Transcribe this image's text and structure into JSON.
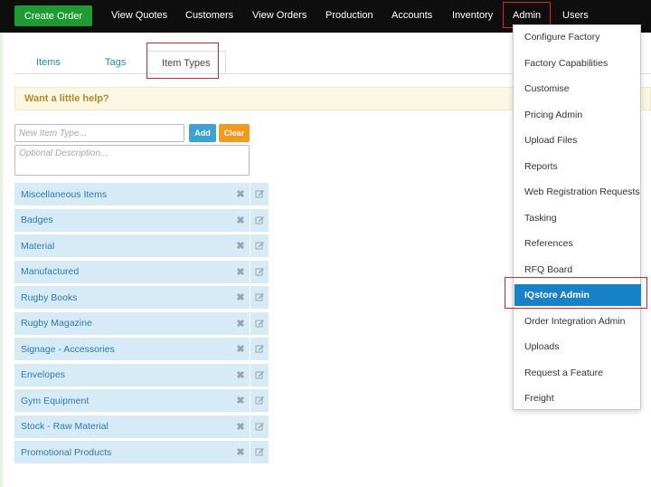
{
  "navbar": {
    "create_order": "Create Order",
    "links": [
      "View Quotes",
      "Customers",
      "View Orders",
      "Production",
      "Accounts",
      "Inventory",
      "Admin",
      "Users"
    ]
  },
  "tabs": [
    "Items",
    "Tags",
    "Item Types"
  ],
  "help": {
    "text": "Want a little help?"
  },
  "form": {
    "new_placeholder": "New Item Type...",
    "desc_placeholder": "Optional Description...",
    "add_label": "Add",
    "clear_label": "Clear"
  },
  "item_types": [
    "Miscellaneous Items",
    "Badges",
    "Material",
    "Manufactured",
    "Rugby Books",
    "Rugby Magazine",
    "Signage - Accessories",
    "Envelopes",
    "Gym Equipment",
    "Stock - Raw Material",
    "Promotional Products"
  ],
  "admin_menu": {
    "items": [
      "Configure Factory",
      "Factory Capabilities",
      "Customise",
      "Pricing Admin",
      "Upload Files",
      "Reports",
      "Web Registration Requests",
      "Tasking",
      "References",
      "RFQ Board",
      "IQstore Admin",
      "Order Integration Admin",
      "Uploads",
      "Request a Feature",
      "Freight"
    ],
    "active": "IQstore Admin"
  },
  "colors": {
    "navbar_bg": "#0e0e0e",
    "create_order_bg": "#1f9b33",
    "link_blue": "#2a87c4",
    "help_bg": "#fcf7e3",
    "row_bg": "#d7ebf6",
    "menu_active_bg": "#1782c8",
    "highlight_red": "#d7262e"
  }
}
